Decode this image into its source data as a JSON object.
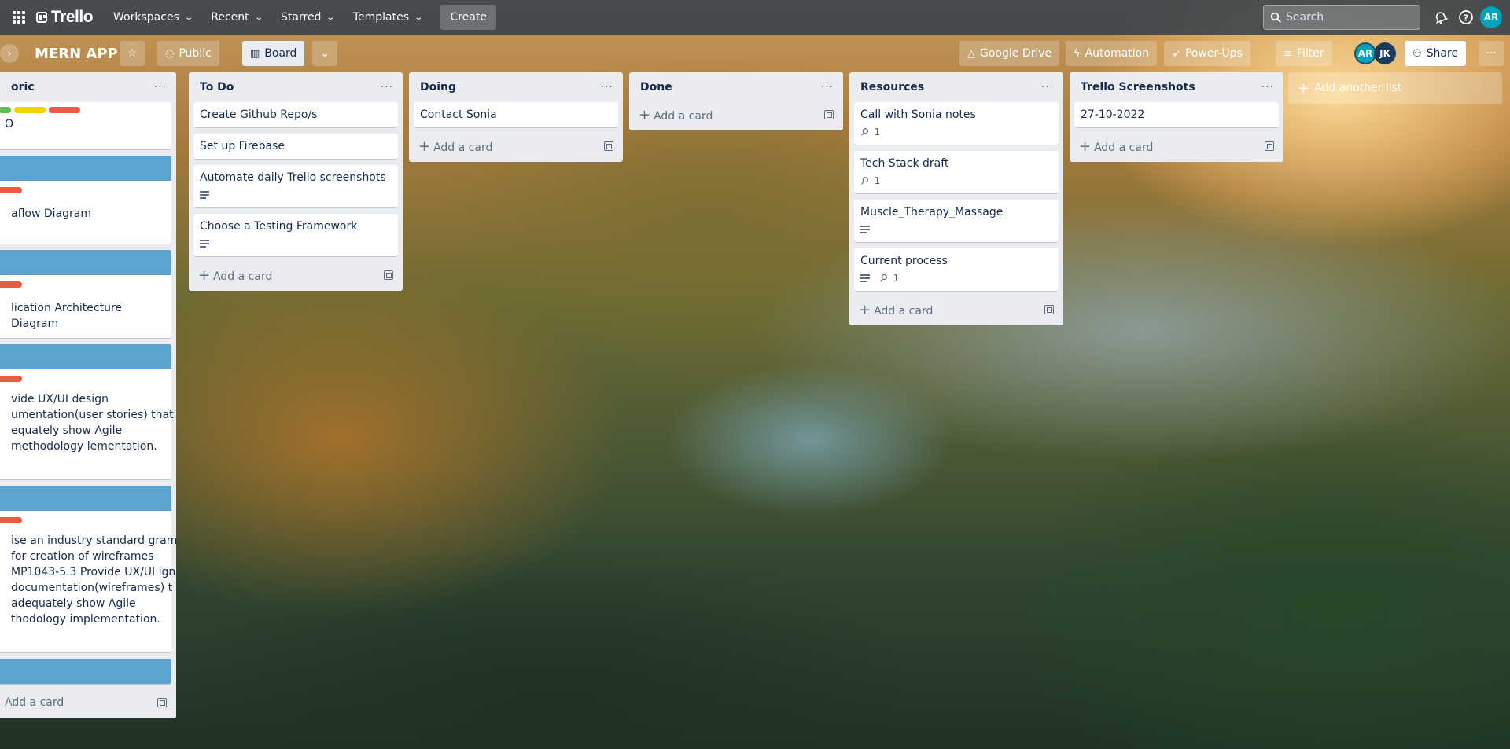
{
  "topnav": {
    "logo": "Trello",
    "menus": [
      {
        "label": "Workspaces"
      },
      {
        "label": "Recent"
      },
      {
        "label": "Starred"
      },
      {
        "label": "Templates"
      }
    ],
    "create_label": "Create",
    "search_placeholder": "Search",
    "user_initials": "AR"
  },
  "board": {
    "title": "MERN APP",
    "visibility": "Public",
    "view": "Board",
    "power_ups": [
      "Google Drive",
      "Automation",
      "Power-Ups"
    ],
    "filter_label": "Filter",
    "members": [
      "AR",
      "JK"
    ],
    "share_label": "Share",
    "add_list_label": "Add another list"
  },
  "lists": [
    {
      "title": "oric",
      "add_label": "Add a card",
      "cards": [
        {
          "title": "O"
        },
        {
          "title": "aflow Diagram"
        },
        {
          "title": "lication Architecture Diagram"
        },
        {
          "title": "vide UX/UI design umentation(user stories) that equately show Agile methodology lementation."
        },
        {
          "title": "ise an industry standard gram for creation of wireframes MP1043-5.3 Provide UX/UI ign documentation(wireframes) t adequately show Agile thodology implementation."
        }
      ]
    },
    {
      "title": "To Do",
      "add_label": "Add a card",
      "cards": [
        {
          "title": "Create Github Repo/s"
        },
        {
          "title": "Set up Firebase"
        },
        {
          "title": "Automate daily Trello screenshots"
        },
        {
          "title": "Choose a Testing Framework"
        }
      ]
    },
    {
      "title": "Doing",
      "add_label": "Add a card",
      "cards": [
        {
          "title": "Contact Sonia"
        }
      ]
    },
    {
      "title": "Done",
      "add_label": "Add a card",
      "cards": []
    },
    {
      "title": "Resources",
      "add_label": "Add a card",
      "cards": [
        {
          "title": "Call with Sonia notes",
          "attachments": "1"
        },
        {
          "title": "Tech Stack draft",
          "attachments": "1"
        },
        {
          "title": "Muscle_Therapy_Massage"
        },
        {
          "title": "Current process",
          "attachments": "1"
        }
      ]
    },
    {
      "title": "Trello Screenshots",
      "add_label": "Add a card",
      "cards": [
        {
          "title": "27-10-2022"
        }
      ]
    }
  ],
  "colors": {
    "nav_bg": "#283c50",
    "list_bg": "#ebecf0",
    "cover_blue": "#5ba4cf",
    "label_green": "#61bd4f",
    "label_yellow": "#f2d600",
    "label_red": "#eb5a46",
    "avatar_teal": "#00a2bd"
  }
}
